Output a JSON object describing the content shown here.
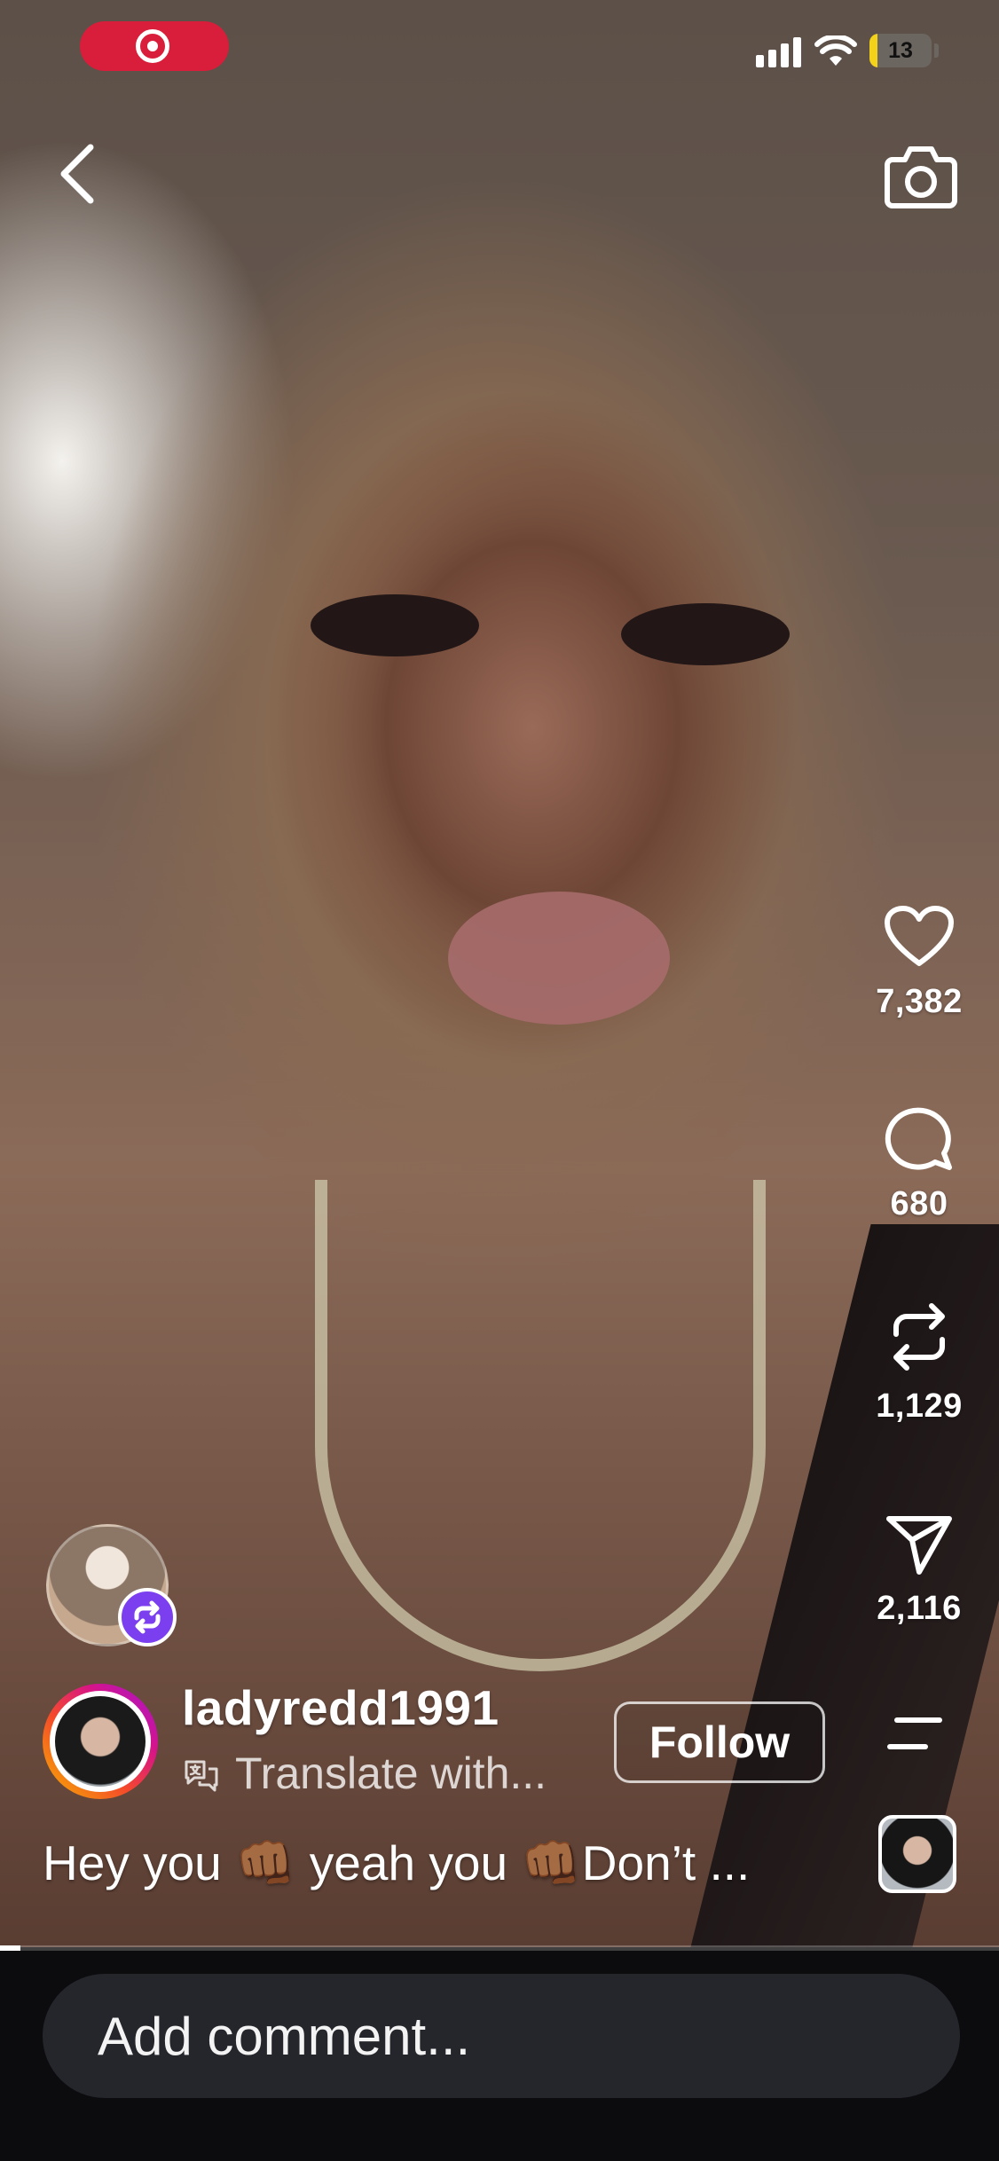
{
  "status_bar": {
    "battery": "13",
    "battery_level": 0.13,
    "recording_color": "#d81e3a"
  },
  "nav": {
    "back_icon": "chevron-left-icon",
    "camera_icon": "camera-icon"
  },
  "actions": {
    "likes": "7,382",
    "comments": "680",
    "reposts": "1,129",
    "shares": "2,116"
  },
  "post": {
    "username": "ladyredd1991",
    "translate": "Translate with...",
    "follow": "Follow",
    "caption": "Hey you 👊🏾 yeah you 👊🏾Don’t ..."
  },
  "playback": {
    "progress": 0.02
  },
  "comment": {
    "placeholder": "Add comment..."
  },
  "colors": {
    "remix_badge": "#7b3ff0",
    "comment_bar": "#25262b"
  }
}
